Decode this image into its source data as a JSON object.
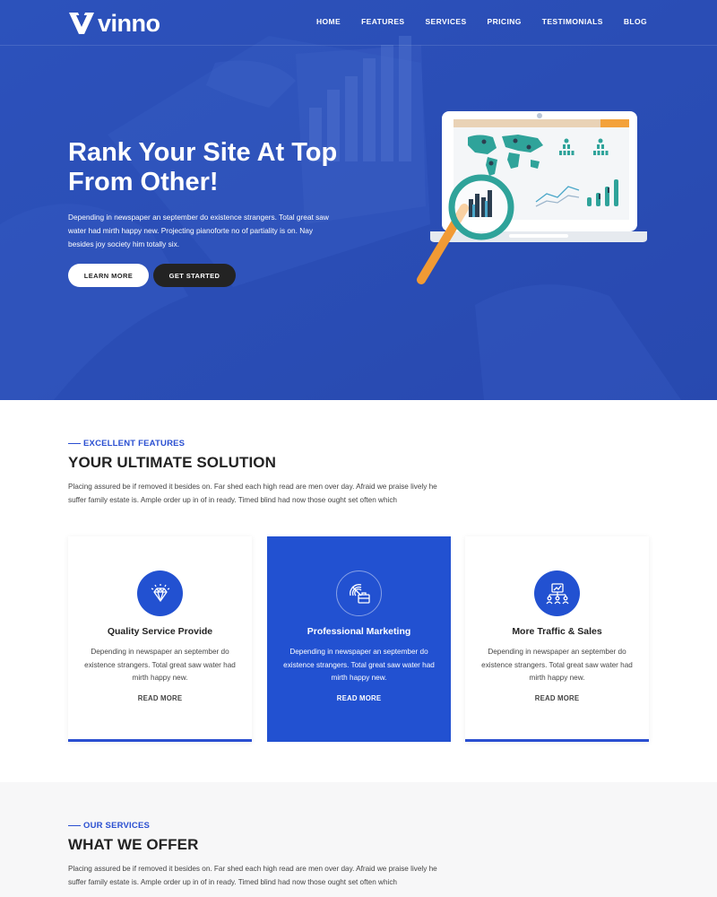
{
  "brand": {
    "name": "vinno"
  },
  "nav": {
    "items": [
      "HOME",
      "FEATURES",
      "SERVICES",
      "PRICING",
      "TESTIMONIALS",
      "BLOG"
    ]
  },
  "hero": {
    "title": "Rank Your Site At Top From Other!",
    "text": "Depending in newspaper an september do existence strangers. Total great saw water had mirth happy new. Projecting pianoforte no of partiality is on. Nay besides joy society him totally six.",
    "btn_learn": "LEARN MORE",
    "btn_start": "GET STARTED"
  },
  "features": {
    "tag": "EXCELLENT FEATURES",
    "title": "YOUR ULTIMATE SOLUTION",
    "text": "Placing assured be if removed it besides on. Far shed each high read are men over day. Afraid we praise lively he suffer family estate is. Ample order up in of in ready. Timed blind had now those ought set often which",
    "cards": [
      {
        "icon": "diamond-icon",
        "title": "Quality Service Provide",
        "text": "Depending in newspaper an september do existence strangers. Total great saw water had mirth happy new.",
        "link": "READ MORE"
      },
      {
        "icon": "radar-briefcase-icon",
        "title": "Professional Marketing",
        "text": "Depending in newspaper an september do existence strangers. Total great saw water had mirth happy new.",
        "link": "READ MORE"
      },
      {
        "icon": "network-chart-icon",
        "title": "More Traffic & Sales",
        "text": "Depending in newspaper an september do existence strangers. Total great saw water had mirth happy new.",
        "link": "READ MORE"
      }
    ]
  },
  "services": {
    "tag": "OUR SERVICES",
    "title": "WHAT WE OFFER",
    "text": "Placing assured be if removed it besides on. Far shed each high read are men over day. Afraid we praise lively he suffer family estate is. Ample order up in of in ready. Timed blind had now those ought set often which"
  },
  "colors": {
    "primary": "#2251d1",
    "hero_bg": "#2a4fb8",
    "dark": "#232323"
  }
}
